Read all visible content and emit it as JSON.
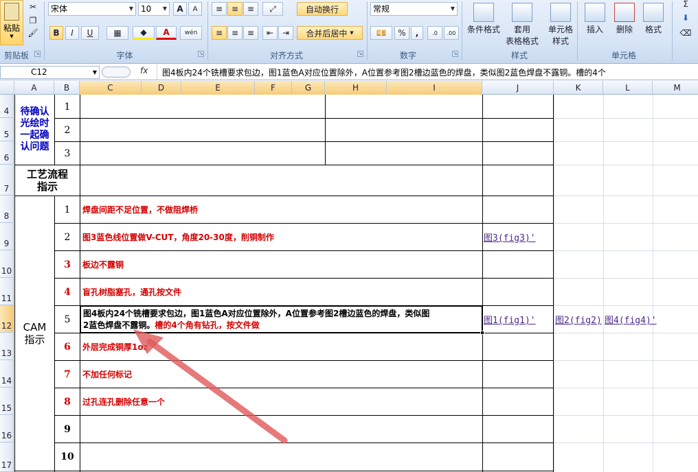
{
  "ribbon": {
    "clipboard": {
      "paste": "粘贴",
      "label": "剪贴板"
    },
    "font": {
      "name": "宋体",
      "size": "10",
      "bold": "B",
      "italic": "I",
      "underline": "U",
      "grow": "A",
      "shrink": "A",
      "label": "字体",
      "color_letter": "A",
      "wen": "wén"
    },
    "align": {
      "wrap": "自动换行",
      "merge": "合并后居中",
      "label": "对齐方式"
    },
    "number": {
      "format": "常规",
      "percent": "%",
      "comma": ",",
      "label": "数字"
    },
    "styles": {
      "cond": "条件格式",
      "table": "套用",
      "table2": "表格格式",
      "cell": "单元格",
      "cell2": "样式",
      "label": "样式"
    },
    "cells": {
      "insert": "插入",
      "delete": "删除",
      "format": "格式",
      "label": "单元格"
    },
    "edit": {
      "sigma": "Σ"
    }
  },
  "formula_bar": {
    "name_box": "C12",
    "fx": "fx",
    "content": "图4板内24个铣槽要求包边，图1蓝色A对应位置除外，A位置参考图2槽边蓝色的焊盘，类似图2蓝色焊盘不露铜。槽的4个"
  },
  "columns": [
    "A",
    "B",
    "C",
    "D",
    "E",
    "F",
    "G",
    "H",
    "I",
    "J",
    "K",
    "L",
    "M"
  ],
  "rows": [
    "4",
    "5",
    "6",
    "7",
    "8",
    "9",
    "10",
    "11",
    "12",
    "13",
    "14",
    "15",
    "16",
    "17"
  ],
  "sections": {
    "confirm": "待确认光绘时一起确认问题",
    "process": "工艺流程指示",
    "cam": "CAM指示"
  },
  "confirm_nums": [
    "1",
    "2",
    "3"
  ],
  "cam_items": [
    {
      "num": "1",
      "text": "焊盘间距不足位置，不做阻焊桥",
      "link": ""
    },
    {
      "num": "2",
      "text": "图3蓝色线位置做V-CUT，角度20-30度，削铜制作",
      "link": "图3(fig3)'"
    },
    {
      "num": "3",
      "text": "板边不露铜",
      "link": ""
    },
    {
      "num": "4",
      "text": "盲孔树脂塞孔，通孔按文件",
      "link": ""
    },
    {
      "num": "5",
      "text": "",
      "link": "图1(fig1)'"
    },
    {
      "num": "6",
      "text": "外层完成铜厚1oz",
      "link": ""
    },
    {
      "num": "7",
      "text": "不加任何标记",
      "link": ""
    },
    {
      "num": "8",
      "text": "过孔连孔删除任意一个",
      "link": ""
    },
    {
      "num": "9",
      "text": "",
      "link": ""
    },
    {
      "num": "10",
      "text": "",
      "link": ""
    }
  ],
  "item5": {
    "black1": "图4板内24个铣槽要求包边，图1蓝色A对应位置除外，A位置参考图2槽边蓝色的焊盘，类似图",
    "black2": "2蓝色焊盘不露铜。",
    "red": "槽的4个角有钻孔，按文件做"
  },
  "extra_links": {
    "k12": "图2(fig2)",
    "l12": "图4(fig4)'"
  },
  "colors": {
    "red": "#d40000",
    "blue_header": "#0000c0",
    "link": "#4b2a8a",
    "arrow": "#e05a5a"
  }
}
